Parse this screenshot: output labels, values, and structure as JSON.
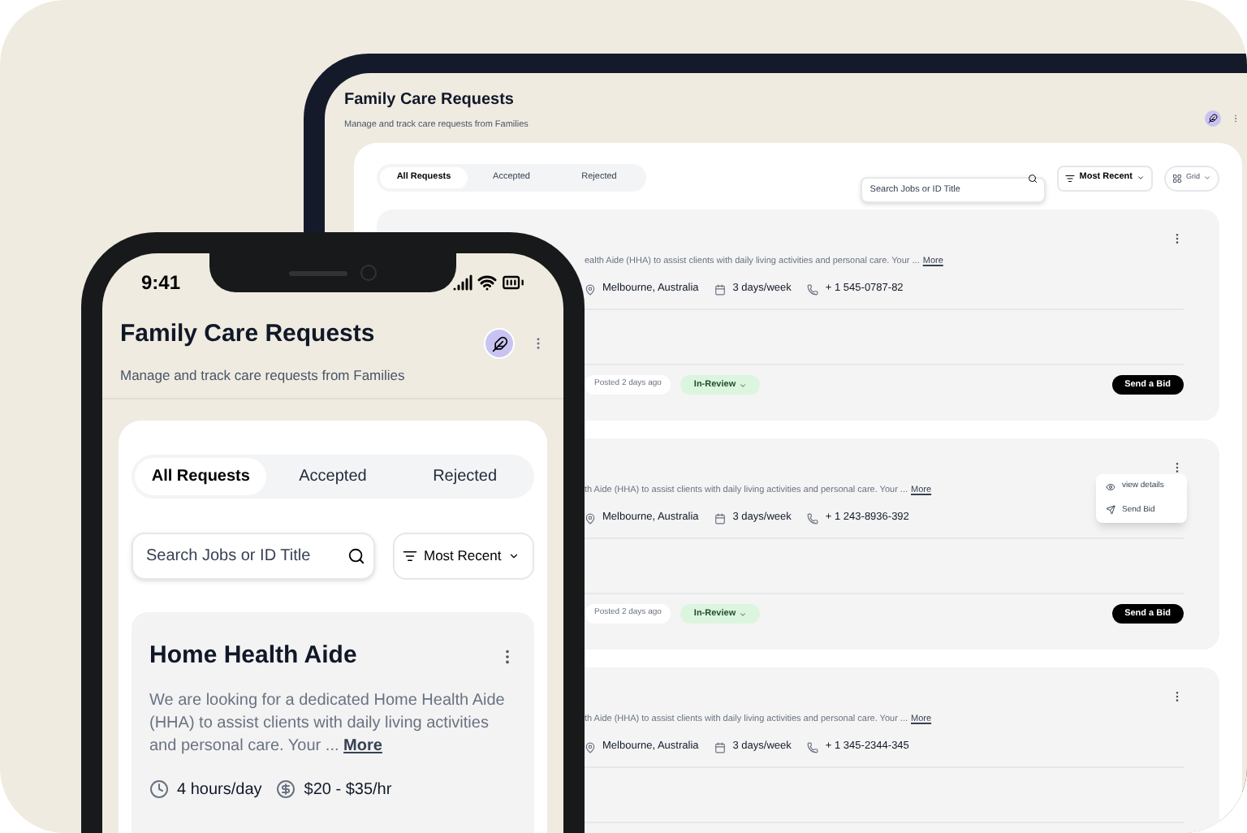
{
  "tablet": {
    "header": {
      "title": "Family Care Requests",
      "subtitle": "Manage and track care requests from Families"
    },
    "tabs": [
      {
        "label": "All Requests",
        "selected": true
      },
      {
        "label": "Accepted",
        "selected": false
      },
      {
        "label": "Rejected",
        "selected": false
      }
    ],
    "search": {
      "placeholder": "Search Jobs or ID Title"
    },
    "sort": {
      "label": "Most Recent"
    },
    "view": {
      "label": "Grid"
    },
    "requests": [
      {
        "description": "ealth Aide (HHA) to assist clients with daily living activities and personal care. Your ...",
        "more": "More",
        "location": "Melbourne, Australia",
        "schedule": "3 days/week",
        "phone": "+ 1 545-0787-82",
        "posted": "Posted 2 days ago",
        "status": "In-Review",
        "action": "Send a Bid"
      },
      {
        "description": "th Aide (HHA) to assist clients with daily living activities and personal care. Your ...",
        "more": "More",
        "location": "Melbourne, Australia",
        "schedule": "3 days/week",
        "phone": "+ 1 243-8936-392",
        "posted": "Posted 2 days ago",
        "status": "In-Review",
        "action": "Send a Bid",
        "menu": [
          {
            "label": "view details",
            "kind": "view"
          },
          {
            "label": "Send Bid",
            "kind": "send"
          }
        ]
      },
      {
        "description": "th Aide (HHA) to assist clients with daily living activities and personal care. Your ...",
        "more": "More",
        "location": "Melbourne, Australia",
        "schedule": "3 days/week",
        "phone": "+ 1 345-2344-345"
      }
    ]
  },
  "phone": {
    "status_bar": {
      "time": "9:41"
    },
    "header": {
      "title": "Family Care Requests",
      "subtitle": "Manage and track care requests from Families"
    },
    "tabs": [
      {
        "label": "All Requests",
        "selected": true
      },
      {
        "label": "Accepted",
        "selected": false
      },
      {
        "label": "Rejected",
        "selected": false
      }
    ],
    "search": {
      "placeholder": "Search Jobs or ID Title"
    },
    "sort": {
      "label": "Most Recent"
    },
    "request": {
      "title": "Home Health Aide",
      "description": "We are looking for a dedicated Home Health Aide (HHA) to assist clients with daily living activities and personal care. Your ...",
      "more": "More",
      "hours": "4 hours/day",
      "rate": "$20 - $35/hr"
    }
  }
}
